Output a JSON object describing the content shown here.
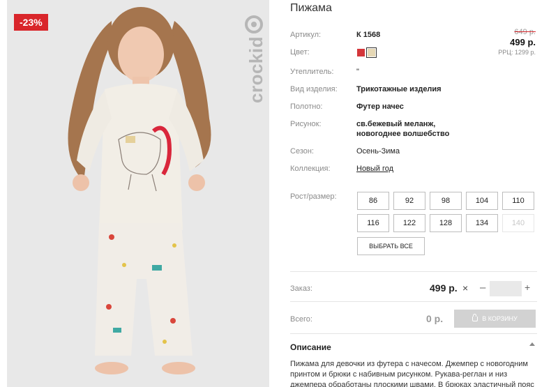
{
  "badge": "-23%",
  "logo": "crockid",
  "product": {
    "title": "Пижама",
    "article_label": "Артикул:",
    "article_value": "К 1568",
    "old_price": "649 р.",
    "price": "499 р.",
    "rrp": "РРЦ: 1299 р.",
    "color_label": "Цвет:",
    "colors": [
      "#d4363a",
      "#e6d8b5"
    ],
    "insulation_label": "Утеплитель:",
    "insulation_value": "\"",
    "type_label": "Вид изделия:",
    "type_value": "Трикотажные изделия",
    "fabric_label": "Полотно:",
    "fabric_value": "Футер начес",
    "pattern_label": "Рисунок:",
    "pattern_value_1": "св.бежевый меланж,",
    "pattern_value_2": "новогоднее волшебство",
    "season_label": "Сезон:",
    "season_value": "Осень-Зима",
    "collection_label": "Коллекция:",
    "collection_value": "Новый год"
  },
  "sizes": {
    "label": "Рост/размер:",
    "row1": [
      "86",
      "92",
      "98",
      "104",
      "110"
    ],
    "row2": [
      "116",
      "122",
      "128",
      "134",
      "140"
    ],
    "select_all": "ВЫБРАТЬ ВСЕ"
  },
  "order": {
    "label": "Заказ:",
    "price": "499 р.",
    "times": "×",
    "minus": "–",
    "plus": "+",
    "quantity": ""
  },
  "total": {
    "label": "Всего:",
    "value": "0 р.",
    "cart_button": "В КОРЗИНУ"
  },
  "description": {
    "title": "Описание",
    "text": "Пижама для девочки из футера с начесом. Джемпер с новогодним принтом и брюки с набивным рисунком. Рукава-реглан и низ джемпера обработаны плоскими швами. В брюках эластичный пояс"
  }
}
